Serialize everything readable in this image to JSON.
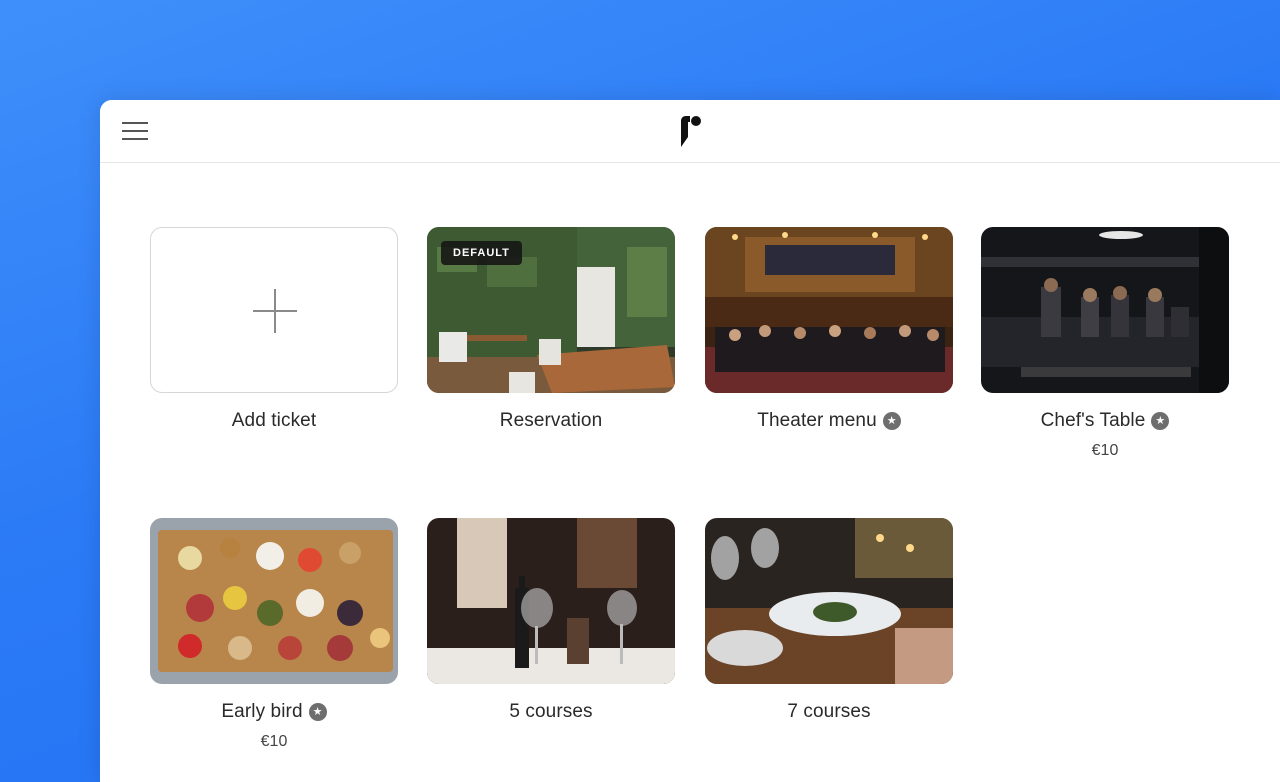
{
  "header": {
    "menu_icon": "hamburger-menu-icon",
    "logo": "brand-logo"
  },
  "tickets": [
    {
      "title": "Add ticket",
      "type": "add",
      "icon": "plus-icon"
    },
    {
      "title": "Reservation",
      "badge": "DEFAULT",
      "image": "restaurant-interior-green-wall"
    },
    {
      "title": "Theater menu",
      "icon": "star-icon",
      "image": "theater-stage-performers"
    },
    {
      "title": "Chef's Table",
      "icon": "star-icon",
      "price": "€10",
      "image": "dark-kitchen-chefs"
    },
    {
      "title": "Early bird",
      "icon": "star-icon",
      "price": "€10",
      "image": "charcuterie-board"
    },
    {
      "title": "5 courses",
      "image": "wine-glasses-table"
    },
    {
      "title": "7 courses",
      "image": "plated-dish-dinner"
    }
  ],
  "colors": {
    "background": "#2b7af6",
    "window": "#ffffff",
    "text": "#2a2a2a",
    "badge": "#6e6e6e"
  }
}
